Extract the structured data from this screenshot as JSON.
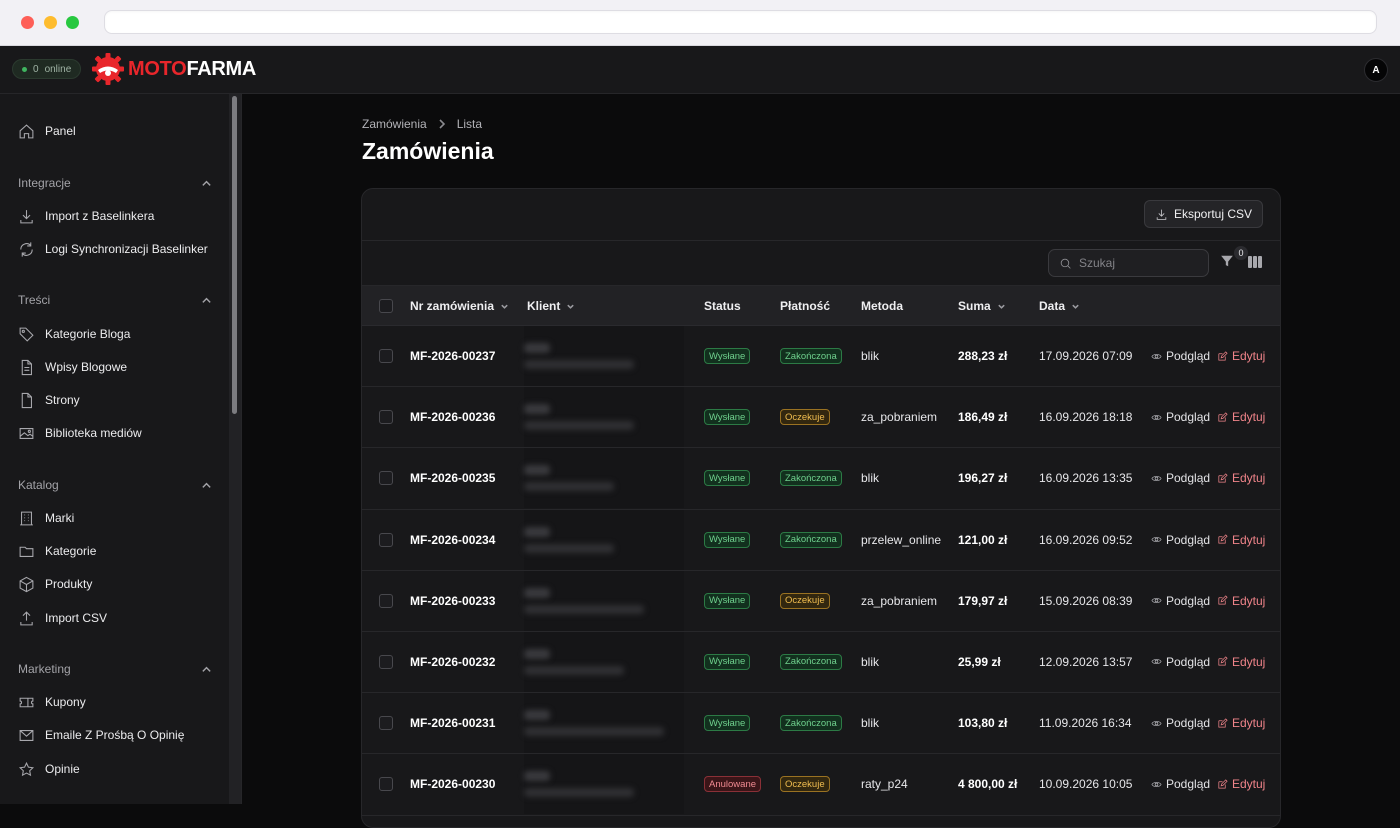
{
  "topbar": {
    "online_count": "0",
    "online_label": "online",
    "logo_part1": "MOTO",
    "logo_part2": "FARMA",
    "avatar_initial": "A"
  },
  "sidebar": {
    "panel": "Panel",
    "groups": [
      {
        "title": "Integracje",
        "items": [
          "Import z Baselinkera",
          "Logi Synchronizacji Baselinker"
        ]
      },
      {
        "title": "Treści",
        "items": [
          "Kategorie Bloga",
          "Wpisy Blogowe",
          "Strony",
          "Biblioteka mediów"
        ]
      },
      {
        "title": "Katalog",
        "items": [
          "Marki",
          "Kategorie",
          "Produkty",
          "Import CSV"
        ]
      },
      {
        "title": "Marketing",
        "items": [
          "Kupony",
          "Emaile Z Prośbą O Opinię",
          "Opinie"
        ]
      }
    ]
  },
  "breadcrumb": {
    "parent": "Zamówienia",
    "current": "Lista"
  },
  "page_title": "Zamówienia",
  "export_label": "Eksportuj CSV",
  "search_placeholder": "Szukaj",
  "filter_count": "0",
  "columns": {
    "order_no": "Nr zamówienia",
    "client": "Klient",
    "status": "Status",
    "payment": "Płatność",
    "method": "Metoda",
    "sum": "Suma",
    "date": "Data"
  },
  "actions": {
    "view": "Podgląd",
    "edit": "Edytuj"
  },
  "colors": {
    "status_green": "#6fd08d",
    "status_yellow": "#f0bd50",
    "status_red": "#f08a91",
    "edit_accent": "#f0848a",
    "brand_red": "#e8262b"
  },
  "orders": [
    {
      "no": "MF-2026-00237",
      "status": "Wysłane",
      "payment": "Zakończona",
      "method": "blik",
      "sum": "288,23 zł",
      "date": "17.09.2026 07:09"
    },
    {
      "no": "MF-2026-00236",
      "status": "Wysłane",
      "payment": "Oczekuje",
      "method": "za_pobraniem",
      "sum": "186,49 zł",
      "date": "16.09.2026 18:18"
    },
    {
      "no": "MF-2026-00235",
      "status": "Wysłane",
      "payment": "Zakończona",
      "method": "blik",
      "sum": "196,27 zł",
      "date": "16.09.2026 13:35"
    },
    {
      "no": "MF-2026-00234",
      "status": "Wysłane",
      "payment": "Zakończona",
      "method": "przelew_online",
      "sum": "121,00 zł",
      "date": "16.09.2026 09:52"
    },
    {
      "no": "MF-2026-00233",
      "status": "Wysłane",
      "payment": "Oczekuje",
      "method": "za_pobraniem",
      "sum": "179,97 zł",
      "date": "15.09.2026 08:39"
    },
    {
      "no": "MF-2026-00232",
      "status": "Wysłane",
      "payment": "Zakończona",
      "method": "blik",
      "sum": "25,99 zł",
      "date": "12.09.2026 13:57"
    },
    {
      "no": "MF-2026-00231",
      "status": "Wysłane",
      "payment": "Zakończona",
      "method": "blik",
      "sum": "103,80 zł",
      "date": "11.09.2026 16:34"
    },
    {
      "no": "MF-2026-00230",
      "status": "Anulowane",
      "payment": "Oczekuje",
      "method": "raty_p24",
      "sum": "4 800,00 zł",
      "date": "10.09.2026 10:05"
    }
  ]
}
